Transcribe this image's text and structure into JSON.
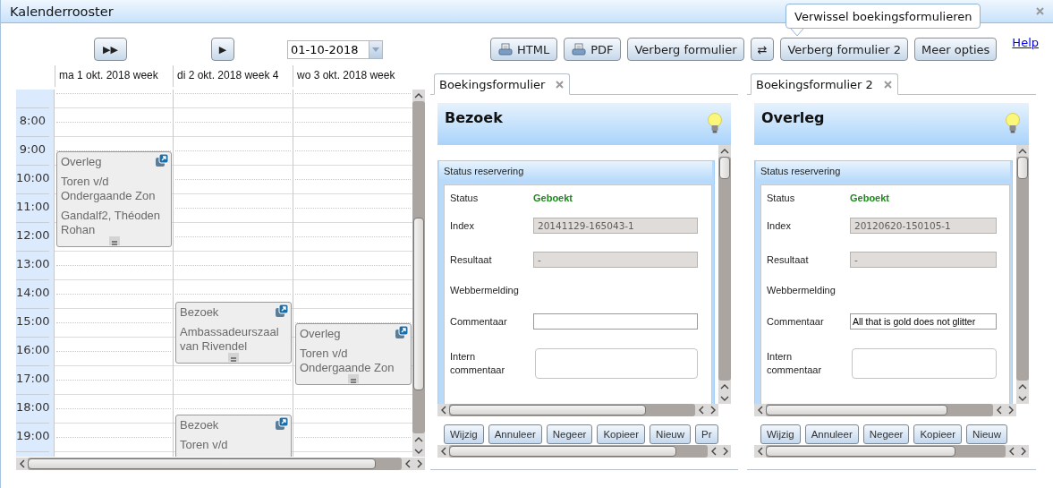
{
  "window": {
    "title": "Kalenderrooster"
  },
  "tooltip": "Verwissel boekingsformulieren",
  "toolbar": {
    "nav_buttons": [
      "▶▶",
      "▶"
    ],
    "date": "01-10-2018",
    "buttons": [
      {
        "label": "HTML",
        "kind": "print"
      },
      {
        "label": "PDF",
        "kind": "print"
      },
      {
        "label": "Verberg formulier",
        "kind": "plain"
      },
      {
        "label": "⇄",
        "kind": "plain"
      },
      {
        "label": "Verberg formulier 2",
        "kind": "plain"
      },
      {
        "label": "Meer opties",
        "kind": "plain"
      }
    ],
    "help_link": "Help"
  },
  "calendar": {
    "hours": [
      "8:00",
      "9:00",
      "10:00",
      "11:00",
      "12:00",
      "13:00",
      "14:00",
      "15:00",
      "16:00",
      "17:00",
      "18:00",
      "19:00"
    ],
    "days": [
      {
        "header": "ma 1 okt. 2018 week",
        "events": [
          {
            "title": "Overleg",
            "lines": [
              "Toren v/d Ondergaande Zon",
              "Gandalf2, Théoden Rohan"
            ]
          }
        ]
      },
      {
        "header": "di 2 okt. 2018 week 4",
        "events": [
          {
            "title": "Bezoek",
            "lines": [
              "Ambassadeurszaal van Rivendel"
            ]
          },
          {
            "title": "Bezoek",
            "lines": [
              "Toren v/d"
            ]
          }
        ]
      },
      {
        "header": "wo 3 okt. 2018 week",
        "events": [
          {
            "title": "Overleg",
            "lines": [
              "Toren v/d Ondergaande Zon"
            ]
          }
        ]
      }
    ]
  },
  "forms": [
    {
      "tab": "Boekingsformulier",
      "title": "Bezoek",
      "section": "Status reservering",
      "fields": [
        {
          "label": "Status",
          "kind": "status",
          "value": "Geboekt"
        },
        {
          "label": "Index",
          "kind": "readonly",
          "value": "20141129-165043-1"
        },
        {
          "label": "Resultaat",
          "kind": "readonly",
          "value": "-"
        },
        {
          "label": "Webbermelding",
          "kind": "none"
        },
        {
          "label": "Commentaar",
          "kind": "text"
        },
        {
          "label": "Intern commentaar",
          "kind": "textarea"
        }
      ],
      "buttons": [
        "Wijzig",
        "Annuleer",
        "Negeer",
        "Kopieer",
        "Nieuw",
        "Pr"
      ]
    },
    {
      "tab": "Boekingsformulier 2",
      "title": "Overleg",
      "section": "Status reservering",
      "fields": [
        {
          "label": "Status",
          "kind": "status",
          "value": "Geboekt"
        },
        {
          "label": "Index",
          "kind": "readonly",
          "value": "20120620-150105-1"
        },
        {
          "label": "Resultaat",
          "kind": "readonly",
          "value": "-"
        },
        {
          "label": "Webbermelding",
          "kind": "none"
        },
        {
          "label": "Commentaar",
          "kind": "text",
          "value": "All that is gold does not glitter"
        },
        {
          "label": "Intern commentaar",
          "kind": "textarea"
        }
      ],
      "buttons": [
        "Wijzig",
        "Annuleer",
        "Negeer",
        "Kopieer",
        "Nieuw"
      ]
    }
  ]
}
